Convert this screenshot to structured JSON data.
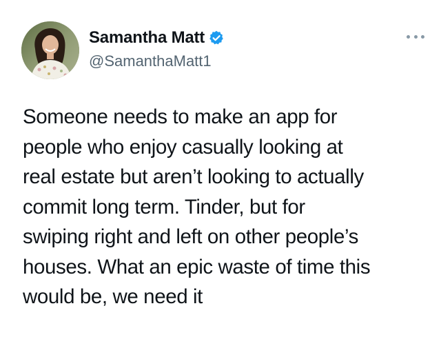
{
  "tweet": {
    "author": {
      "display_name": "Samantha Matt",
      "handle": "@SamanthaMatt1",
      "verified": true,
      "avatar_icon": "profile-photo",
      "verified_icon": "verified-badge-icon"
    },
    "more_icon": "more-options-icon",
    "text_lines": [
      "Someone needs to make an app for",
      "people who enjoy casually looking at",
      "real estate but aren’t looking to actually",
      "commit long term. Tinder, but for",
      "swiping right and left on other people’s",
      "houses. What an epic waste of time this",
      "would be, we need it"
    ]
  },
  "colors": {
    "text": "#0f1419",
    "secondary_text": "#536471",
    "verified_blue": "#1d9bf0",
    "more_dots": "#8899a6"
  }
}
